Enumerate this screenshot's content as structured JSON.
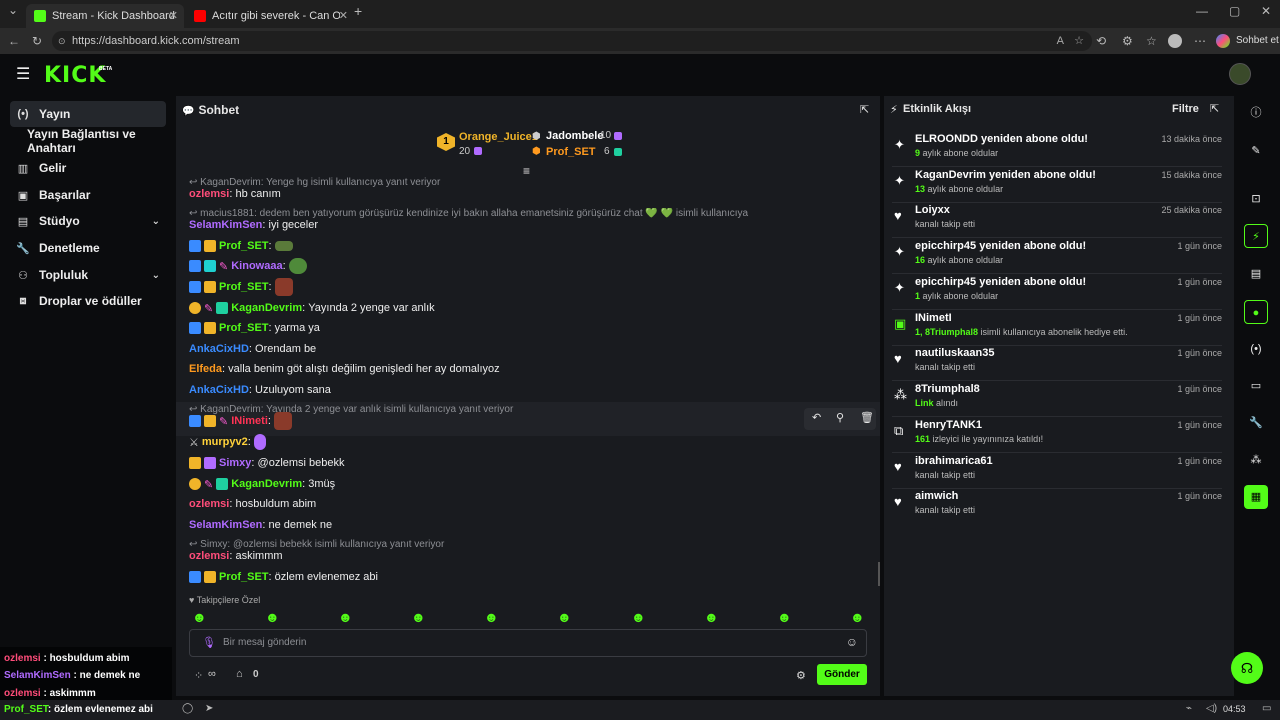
{
  "browser": {
    "tabs": [
      {
        "title": "Stream - Kick Dashboard",
        "active": true
      },
      {
        "title": "Acıtır gibi severek - Can Ozan",
        "active": false
      }
    ],
    "url": "https://dashboard.kick.com/stream",
    "profile_button": "Sohbet et"
  },
  "app": {
    "logo": "KICK",
    "beta": "BETA"
  },
  "sidebar": {
    "items": [
      {
        "label": "Yayın",
        "icon": "broadcast-icon",
        "active": true
      },
      {
        "label": "Yayın Bağlantısı ve Anahtarı",
        "sub": true
      },
      {
        "label": "Gelir",
        "icon": "chart-icon"
      },
      {
        "label": "Başarılar",
        "icon": "trophy-icon"
      },
      {
        "label": "Stüdyo",
        "icon": "studio-icon",
        "expandable": true
      },
      {
        "label": "Denetleme",
        "icon": "wrench-icon"
      },
      {
        "label": "Topluluk",
        "icon": "community-icon",
        "expandable": true
      },
      {
        "label": "Droplar ve ödüller",
        "icon": "gift-icon"
      }
    ]
  },
  "chat": {
    "title": "Sohbet",
    "leaderboard": [
      {
        "rank": "1",
        "name": "Orange_Juice1",
        "count": "20"
      },
      {
        "name": "Jadombele",
        "count": "10"
      },
      {
        "name": "Prof_SET",
        "count": "6"
      }
    ],
    "messages": [
      {
        "reply": "KaganDevrim: Yenge hg isimli kullanıcıya yanıt veriyor"
      },
      {
        "user": "ozlemsi",
        "color": "#ff4d7a",
        "text": "hb canım"
      },
      {
        "reply": "macius1881: dedem ben yatıyorum görüşürüz kendinize iyi bakın allaha emanetsiniz görüşürüz chat 💚 💚 isimli kullanıcıya yanıt veriyor"
      },
      {
        "user": "SelamKimSen",
        "color": "#b06bff",
        "text": "iyi geceler"
      },
      {
        "user": "Prof_SET",
        "color": "#53fc18",
        "text": ""
      },
      {
        "user": "Kinowaaa",
        "color": "#b06bff",
        "text": ""
      },
      {
        "user": "Prof_SET",
        "color": "#53fc18",
        "text": ""
      },
      {
        "user": "KaganDevrim",
        "color": "#53fc18",
        "text": "Yayında 2 yenge var anlık"
      },
      {
        "user": "Prof_SET",
        "color": "#53fc18",
        "text": "yarma ya"
      },
      {
        "user": "AnkaCixHD",
        "color": "#3a8bff",
        "text": "Orendam be"
      },
      {
        "user": "Elfeda",
        "color": "#ff9a1f",
        "text": "valla benim göt alıştı değilim genişledi her ay domalıyoz"
      },
      {
        "user": "AnkaCixHD",
        "color": "#3a8bff",
        "text": "Uzuluyom sana"
      },
      {
        "reply": "KaganDevrim: Yayında 2 yenge var anlık isimli kullanıcıya yanıt veriyor"
      },
      {
        "user": "INimeti",
        "color": "#ff3355",
        "text": ""
      },
      {
        "user": "murpyv2",
        "color": "#ffd23a",
        "text": ""
      },
      {
        "user": "Simxy",
        "color": "#b06bff",
        "text": "@ozlemsi bebekk"
      },
      {
        "user": "KaganDevrim",
        "color": "#53fc18",
        "text": "3müş"
      },
      {
        "user": "ozlemsi",
        "color": "#ff4d7a",
        "text": "hosbuldum abim"
      },
      {
        "user": "SelamKimSen",
        "color": "#b06bff",
        "text": "ne demek ne"
      },
      {
        "reply": "Simxy: @ozlemsi bebekk isimli kullanıcıya yanıt veriyor"
      },
      {
        "user": "ozlemsi",
        "color": "#ff4d7a",
        "text": "askimmm"
      },
      {
        "user": "Prof_SET",
        "color": "#53fc18",
        "text": "özlem evlenemez abi"
      }
    ],
    "followers_only": "Takipçilere Özel",
    "input_placeholder": "Bir mesaj gönderin",
    "infinity_label": "∞",
    "count_label": "0",
    "send_label": "Gönder"
  },
  "activity": {
    "title": "Etkinlik Akışı",
    "filter_label": "Filtre",
    "events": [
      {
        "icon": "sparkle-icon",
        "title": "ELROONDD yeniden abone oldu!",
        "hl": "9",
        "sub": " aylık abone oldular",
        "time": "13 dakika önce"
      },
      {
        "icon": "sparkle-icon",
        "title": "KaganDevrim yeniden abone oldu!",
        "hl": "13",
        "sub": " aylık abone oldular",
        "time": "15 dakika önce"
      },
      {
        "icon": "heart-icon",
        "title": "Loiyxx",
        "hl": "",
        "sub": "kanalı takip etti",
        "time": "25 dakika önce"
      },
      {
        "icon": "sparkle-icon",
        "title": "epicchirp45 yeniden abone oldu!",
        "hl": "16",
        "sub": " aylık abone oldular",
        "time": "1 gün önce"
      },
      {
        "icon": "sparkle-icon",
        "title": "epicchirp45 yeniden abone oldu!",
        "hl": "1",
        "sub": " aylık abone oldular",
        "time": "1 gün önce"
      },
      {
        "icon": "gift-icon",
        "title": "INimetI",
        "hl": "1, 8Triumphal8",
        "sub": " isimli kullanıcıya abonelik hediye etti.",
        "time": "1 gün önce"
      },
      {
        "icon": "heart-icon",
        "title": "nautiluskaan35",
        "hl": "",
        "sub": "kanalı takip etti",
        "time": "1 gün önce"
      },
      {
        "icon": "drop-icon",
        "title": "8Triumphal8",
        "hl": "Link",
        "sub": " alındı",
        "time": "1 gün önce"
      },
      {
        "icon": "host-icon",
        "title": "HenryTANK1",
        "hl": "161",
        "sub": " izleyici ile yayınınıza katıldı!",
        "time": "1 gün önce"
      },
      {
        "icon": "heart-icon",
        "title": "ibrahimarica61",
        "hl": "",
        "sub": "kanalı takip etti",
        "time": "1 gün önce"
      },
      {
        "icon": "heart-icon",
        "title": "aimwich",
        "hl": "",
        "sub": "kanalı takip etti",
        "time": "1 gün önce"
      }
    ]
  },
  "overlay": [
    {
      "user": "ozlemsi",
      "text": "hosbuldum abim",
      "color": "#ff4d7a"
    },
    {
      "user": "SelamKimSen",
      "text": "ne demek ne",
      "color": "#b06bff"
    },
    {
      "user": "ozlemsi",
      "text": "askimmm",
      "color": "#ff4d7a"
    },
    {
      "user": "Prof_SET",
      "text": "özlem evlenemez abi",
      "color": "#53fc18"
    }
  ],
  "taskbar": {
    "time": "04:53"
  },
  "colors": {
    "accent": "#53fc18",
    "panel": "#191b1f",
    "bg": "#0b0c0e"
  }
}
